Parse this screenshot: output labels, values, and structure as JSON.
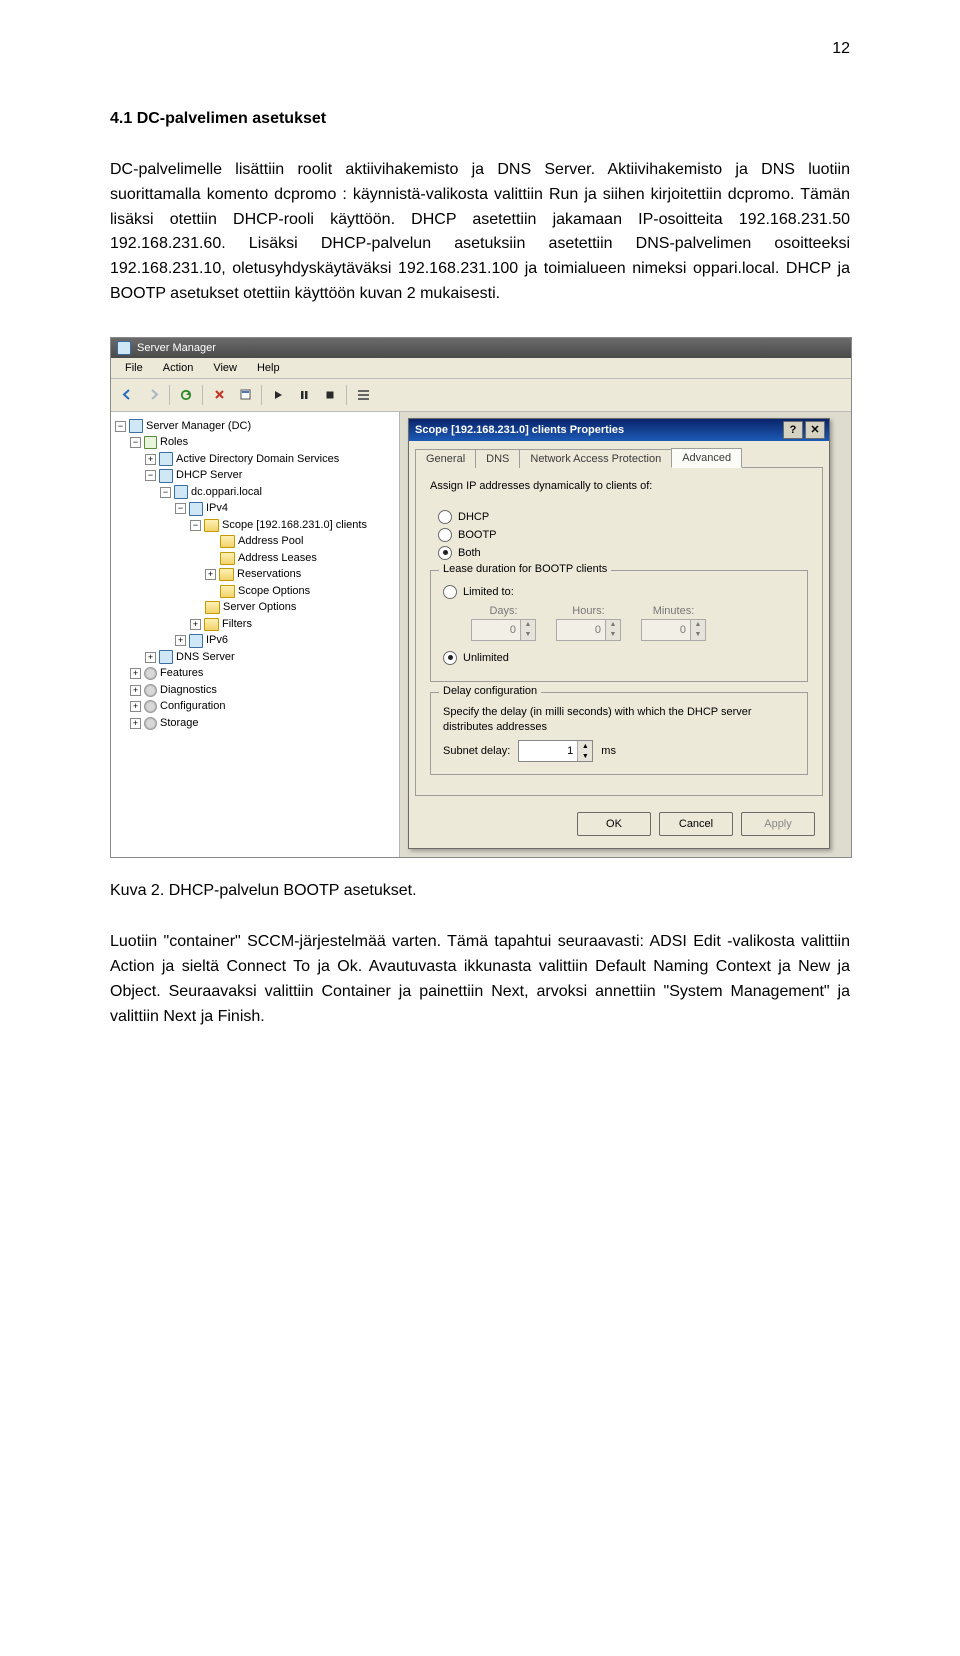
{
  "page_number": "12",
  "heading": "4.1   DC-palvelimen asetukset",
  "para1": "DC-palvelimelle lisättiin roolit aktiivihakemisto ja DNS Server. Aktiivihakemisto ja DNS luotiin suorittamalla komento dcpromo : käynnistä-valikosta valittiin Run ja siihen kirjoitettiin dcpromo. Tämän lisäksi otettiin DHCP-rooli käyttöön. DHCP asetettiin jakamaan IP-osoitteita 192.168.231.50 192.168.231.60. Lisäksi DHCP-palvelun asetuksiin asetettiin DNS-palvelimen osoitteeksi 192.168.231.10, oletusyhdyskäytäväksi 192.168.231.100 ja toimialueen nimeksi oppari.local. DHCP ja BOOTP asetukset otettiin käyttöön kuvan 2 mukaisesti.",
  "caption": "Kuva 2. DHCP-palvelun BOOTP asetukset.",
  "para2": "Luotiin \"container\" SCCM-järjestelmää varten. Tämä tapahtui seuraavasti: ADSI Edit -valikosta valittiin Action ja sieltä Connect To ja Ok. Avautuvasta ikkunasta valittiin Default Naming Context ja New ja Object. Seuraavaksi valittiin Container ja painettiin Next, arvoksi annettiin \"System Management\" ja valittiin Next ja Finish.",
  "server_manager": {
    "title": "Server Manager",
    "menus": [
      "File",
      "Action",
      "View",
      "Help"
    ],
    "tree": {
      "root": "Server Manager (DC)",
      "items": [
        {
          "label": "Roles",
          "depth": 1,
          "exp": "−",
          "icon": "role-ico",
          "children": [
            {
              "label": "Active Directory Domain Services",
              "depth": 2,
              "exp": "+",
              "icon": "server-ico"
            },
            {
              "label": "DHCP Server",
              "depth": 2,
              "exp": "−",
              "icon": "server-ico",
              "children": [
                {
                  "label": "dc.oppari.local",
                  "depth": 3,
                  "exp": "−",
                  "icon": "server-ico",
                  "children": [
                    {
                      "label": "IPv4",
                      "depth": 4,
                      "exp": "−",
                      "icon": "server-ico",
                      "children": [
                        {
                          "label": "Scope [192.168.231.0] clients",
                          "depth": 5,
                          "exp": "−",
                          "icon": "folder-ico",
                          "children": [
                            {
                              "label": "Address Pool",
                              "depth": 6,
                              "icon": "folder-ico"
                            },
                            {
                              "label": "Address Leases",
                              "depth": 6,
                              "icon": "folder-ico"
                            },
                            {
                              "label": "Reservations",
                              "depth": 6,
                              "exp": "+",
                              "icon": "folder-ico"
                            },
                            {
                              "label": "Scope Options",
                              "depth": 6,
                              "icon": "folder-ico"
                            }
                          ]
                        },
                        {
                          "label": "Server Options",
                          "depth": 5,
                          "icon": "folder-ico"
                        },
                        {
                          "label": "Filters",
                          "depth": 5,
                          "exp": "+",
                          "icon": "folder-ico"
                        }
                      ]
                    },
                    {
                      "label": "IPv6",
                      "depth": 4,
                      "exp": "+",
                      "icon": "server-ico"
                    }
                  ]
                }
              ]
            },
            {
              "label": "DNS Server",
              "depth": 2,
              "exp": "+",
              "icon": "server-ico"
            }
          ]
        },
        {
          "label": "Features",
          "depth": 1,
          "exp": "+",
          "icon": "gear-ico"
        },
        {
          "label": "Diagnostics",
          "depth": 1,
          "exp": "+",
          "icon": "gear-ico"
        },
        {
          "label": "Configuration",
          "depth": 1,
          "exp": "+",
          "icon": "gear-ico"
        },
        {
          "label": "Storage",
          "depth": 1,
          "exp": "+",
          "icon": "gear-ico"
        }
      ]
    }
  },
  "dialog": {
    "title": "Scope [192.168.231.0] clients Properties",
    "tabs": [
      "General",
      "DNS",
      "Network Access Protection",
      "Advanced"
    ],
    "active_tab": 3,
    "assign_label": "Assign IP addresses dynamically to clients of:",
    "assign_options": [
      "DHCP",
      "BOOTP",
      "Both"
    ],
    "assign_selected": 2,
    "lease_legend": "Lease duration for BOOTP clients",
    "limited_label": "Limited to:",
    "unlimited_label": "Unlimited",
    "lease_selected": "unlimited",
    "duration_cols": [
      {
        "label": "Days:",
        "value": "0"
      },
      {
        "label": "Hours:",
        "value": "0"
      },
      {
        "label": "Minutes:",
        "value": "0"
      }
    ],
    "delay_legend": "Delay configuration",
    "delay_text": "Specify the delay (in milli seconds) with which the DHCP server distributes addresses",
    "delay_label": "Subnet delay:",
    "delay_value": "1",
    "delay_unit": "ms",
    "buttons": {
      "ok": "OK",
      "cancel": "Cancel",
      "apply": "Apply"
    }
  }
}
